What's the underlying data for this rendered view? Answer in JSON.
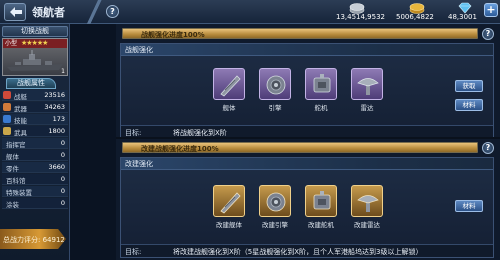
{
  "header": {
    "title": "领航者",
    "help_symbol": "?",
    "resources": [
      {
        "icon": "silver-coin-icon",
        "value": "13,4514,9532"
      },
      {
        "icon": "gold-coin-icon",
        "value": "5006,4822"
      },
      {
        "icon": "gem-icon",
        "value": "48,3001"
      }
    ],
    "add_symbol": "+"
  },
  "sidebar": {
    "switch_label": "切换战舰",
    "ship_rank": "小型",
    "stars": "★★★★★",
    "ship_count": "1",
    "props_tab": "战舰属性",
    "stats": [
      {
        "icon_color": "#d04a3a",
        "name": "战艇",
        "value": "23516"
      },
      {
        "icon_color": "#d07a3a",
        "name": "武器",
        "value": "34263"
      },
      {
        "icon_color": "#3a7ad0",
        "name": "技能",
        "value": "173"
      },
      {
        "icon_color": "#c9a64a",
        "name": "武具",
        "value": "1800"
      },
      {
        "icon_color": "#5a6a7e",
        "name": "指挥官",
        "value": "0"
      },
      {
        "icon_color": "#5a6a7e",
        "name": "舰体",
        "value": "0"
      },
      {
        "icon_color": "#5a6a7e",
        "name": "零件",
        "value": "3660"
      },
      {
        "icon_color": "#5a6a7e",
        "name": "百科馆",
        "value": "0"
      },
      {
        "icon_color": "#5a6a7e",
        "name": "特殊装置",
        "value": "0"
      },
      {
        "icon_color": "#5a6a7e",
        "name": "涂装",
        "value": "0"
      }
    ],
    "power_label": "总战力评分",
    "power_value": "64912"
  },
  "section1": {
    "progress_text": "战舰强化进度100%",
    "progress": 1.0,
    "header": "战舰强化",
    "items": [
      {
        "label": "舰体",
        "icon": "hull-icon"
      },
      {
        "label": "引擎",
        "icon": "engine-icon"
      },
      {
        "label": "舵机",
        "icon": "rudder-icon"
      },
      {
        "label": "雷达",
        "icon": "radar-icon"
      }
    ],
    "btn_acquire": "获取",
    "btn_material": "材料",
    "target_label": "目标:",
    "target_text": "将战舰强化到X阶"
  },
  "section2": {
    "progress_text": "改建战舰强化进度100%",
    "progress": 1.0,
    "header": "改建强化",
    "items": [
      {
        "label": "改建舰体",
        "icon": "refit-hull-icon"
      },
      {
        "label": "改建引擎",
        "icon": "refit-engine-icon"
      },
      {
        "label": "改建舵机",
        "icon": "refit-rudder-icon"
      },
      {
        "label": "改建雷达",
        "icon": "refit-radar-icon"
      }
    ],
    "btn_material": "材料",
    "target_label": "目标:",
    "target_text": "将改建战舰强化到X阶（5星战舰强化到X阶，且个人军港船坞达到3级以上解锁）"
  }
}
